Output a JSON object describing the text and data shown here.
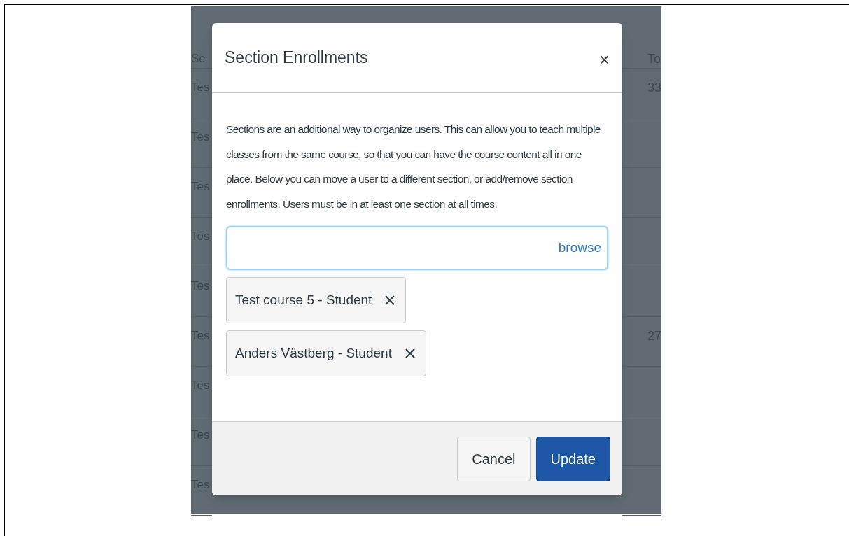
{
  "background_table": {
    "column_1": "Se",
    "column_2": "To",
    "rows": [
      {
        "column_1": "Tes",
        "column_2": "33"
      },
      {
        "column_1": "Tes"
      },
      {
        "column_1": "Tes"
      },
      {
        "column_1": "Tes"
      },
      {
        "column_1": "Tes"
      },
      {
        "column_1": "Tes",
        "column_2": "27"
      },
      {
        "column_1": "Tes"
      },
      {
        "column_1": "Tes"
      },
      {
        "column_1": "Tes"
      }
    ]
  },
  "dialog": {
    "title": "Section Enrollments",
    "close": "×",
    "description": "Sections are an additional way to organize users. This can allow you to teach multiple classes from the same course, so that you can have the course content all in one place. Below you can move a user to a different section, or add/remove section enrollments. Users must be in at least one section at all times.",
    "search": {
      "link": "browse"
    },
    "enrollments": [
      {
        "label": "Test course 5 - Student"
      },
      {
        "label": "Anders Västberg - Student"
      }
    ],
    "buttons": [
      {
        "label": "Cancel",
        "kind": "secondary"
      },
      {
        "label": "Update",
        "kind": "primary"
      }
    ]
  }
}
